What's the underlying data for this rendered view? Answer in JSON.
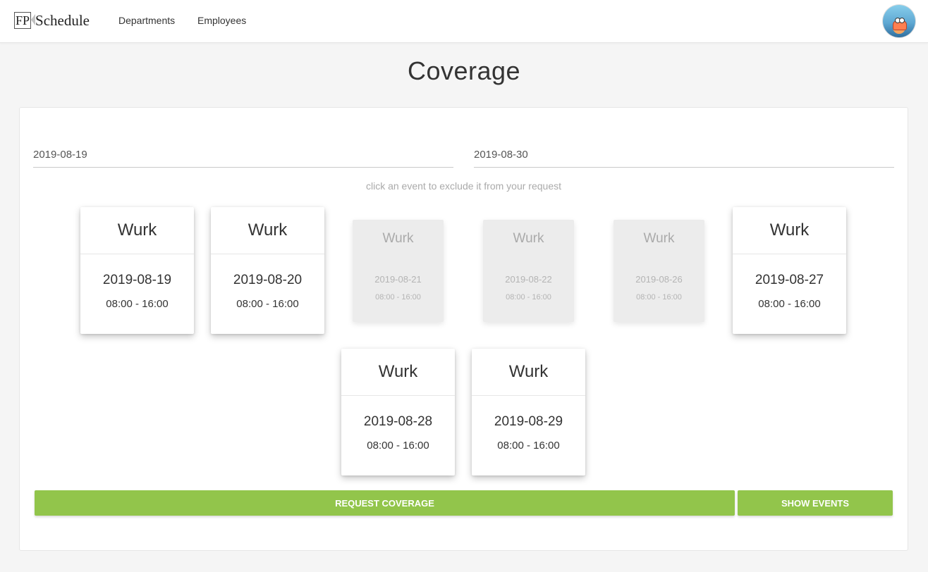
{
  "nav": {
    "logo_fp": "FP",
    "logo_text": "Schedule",
    "links": [
      "Departments",
      "Employees"
    ]
  },
  "page": {
    "title": "Coverage"
  },
  "form": {
    "start_date": "2019-08-19",
    "end_date": "2019-08-30",
    "hint": "click an event to exclude it from your request"
  },
  "events": [
    {
      "title": "Wurk",
      "date": "2019-08-19",
      "time": "08:00 - 16:00",
      "excluded": false
    },
    {
      "title": "Wurk",
      "date": "2019-08-20",
      "time": "08:00 - 16:00",
      "excluded": false
    },
    {
      "title": "Wurk",
      "date": "2019-08-21",
      "time": "08:00 - 16:00",
      "excluded": true
    },
    {
      "title": "Wurk",
      "date": "2019-08-22",
      "time": "08:00 - 16:00",
      "excluded": true
    },
    {
      "title": "Wurk",
      "date": "2019-08-26",
      "time": "08:00 - 16:00",
      "excluded": true
    },
    {
      "title": "Wurk",
      "date": "2019-08-27",
      "time": "08:00 - 16:00",
      "excluded": false
    },
    {
      "title": "Wurk",
      "date": "2019-08-28",
      "time": "08:00 - 16:00",
      "excluded": false
    },
    {
      "title": "Wurk",
      "date": "2019-08-29",
      "time": "08:00 - 16:00",
      "excluded": false
    }
  ],
  "buttons": {
    "request": "REQUEST COVERAGE",
    "show": "SHOW EVENTS"
  },
  "colors": {
    "accent": "#92c54b",
    "excluded_card": "#ececec"
  }
}
